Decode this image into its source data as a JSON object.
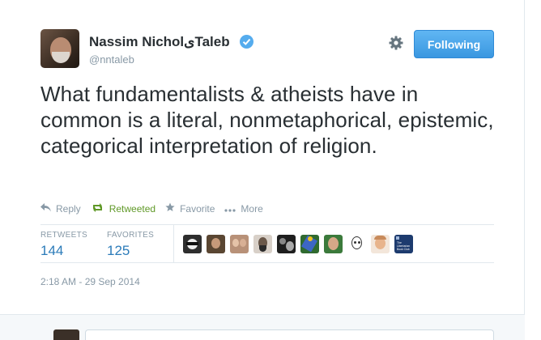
{
  "tweet": {
    "author_name": "Nassim NicholیTaleb",
    "author_handle": "@nntaleb",
    "verified": true,
    "follow_label": "Following",
    "text": "What fundamentalists & atheists have in common is a literal, nonmetaphorical, epistemic, categorical interpretation of religion.",
    "actions": {
      "reply": "Reply",
      "retweeted": "Retweeted",
      "favorite": "Favorite",
      "more": "More"
    },
    "stats": {
      "retweets_label": "RETWEETS",
      "retweets_value": "144",
      "favorites_label": "FAVORITES",
      "favorites_value": "125"
    },
    "favoriters_extra_label": "The Libertarian Book Club",
    "timestamp": "2:18 AM - 29 Sep 2014"
  },
  "colors": {
    "accent": "#55acee",
    "retweeted": "#609928",
    "muted": "#8899a6",
    "link": "#2b7bb9"
  }
}
